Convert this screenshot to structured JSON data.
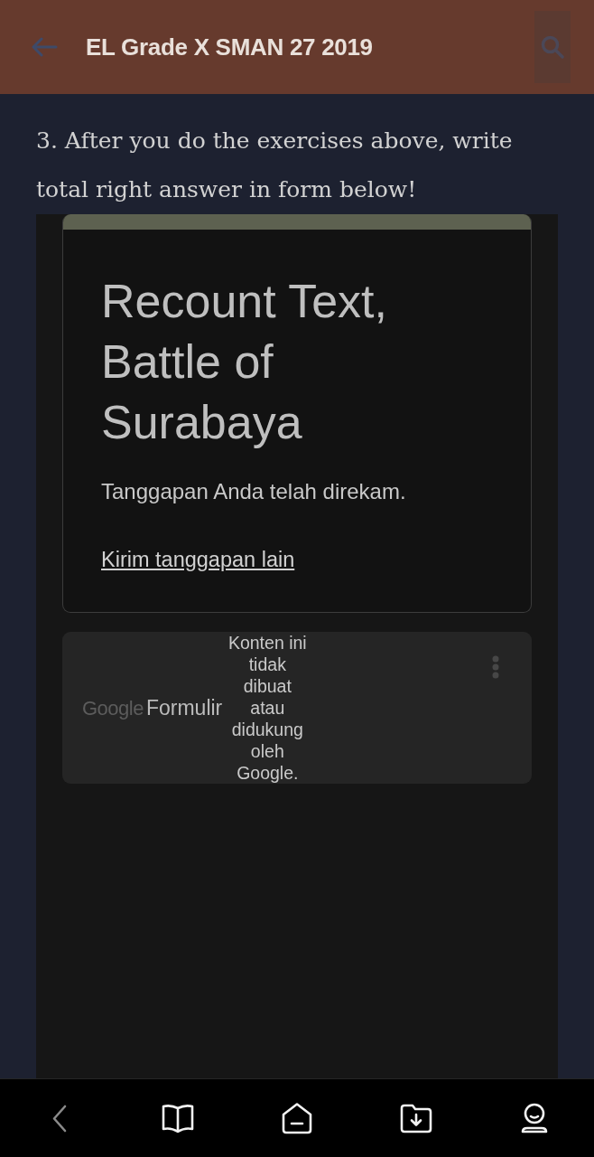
{
  "app_bar": {
    "title": "EL Grade X SMAN 27 2019"
  },
  "post": {
    "paragraph": "3. After you do the exercises above, write total right answer in form below!"
  },
  "form": {
    "title": "Recount Text, Battle of Surabaya",
    "message": "Tanggapan Anda telah direkam.",
    "link": "Kirim tanggapan lain"
  },
  "form_footer": {
    "logo_brand": "Google",
    "logo_product": "Formulir",
    "disclaimer": "Konten ini tidak dibuat atau didukung oleh Google."
  },
  "bottom_nav": [
    {
      "kind": "back",
      "disabled": true
    },
    {
      "kind": "book",
      "disabled": false
    },
    {
      "kind": "home",
      "disabled": false
    },
    {
      "kind": "downloads",
      "disabled": false
    },
    {
      "kind": "profile",
      "disabled": false
    }
  ]
}
